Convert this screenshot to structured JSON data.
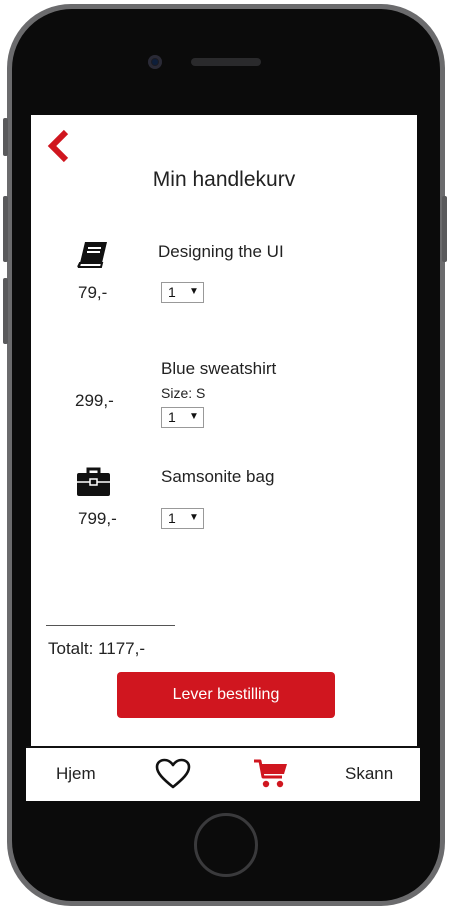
{
  "header": {
    "back_icon": "chevron-left-icon",
    "title": "Min handlekurv"
  },
  "cart": {
    "items": [
      {
        "name": "Designing the UI",
        "price": "79,-",
        "size": "",
        "quantity": "1",
        "icon": "book-icon"
      },
      {
        "name": "Blue sweatshirt",
        "price": "299,-",
        "size": "Size: S",
        "quantity": "1",
        "icon": ""
      },
      {
        "name": "Samsonite bag",
        "price": "799,-",
        "size": "",
        "quantity": "1",
        "icon": "briefcase-icon"
      }
    ],
    "quantity_arrow": "▼",
    "total": "Totalt: 1177,-",
    "order_button": "Lever bestilling"
  },
  "nav": {
    "home_label": "Hjem",
    "favorites_icon": "heart-icon",
    "cart_icon": "shopping-cart-icon",
    "scan_label": "Skann"
  },
  "colors": {
    "accent": "#d0161f",
    "text": "#222222",
    "phone_frame": "#0b0b0b"
  }
}
